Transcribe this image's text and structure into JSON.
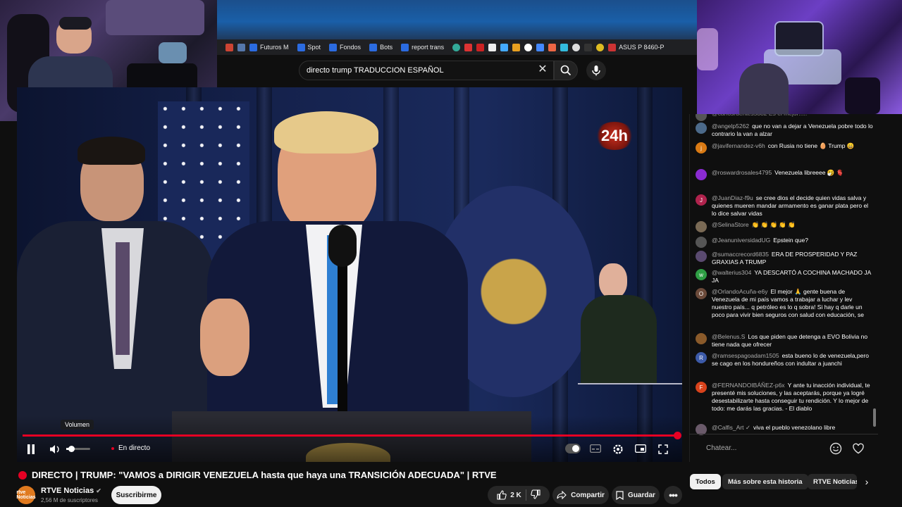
{
  "bookmarks": [
    "Futuros M",
    "Spot",
    "Fondos",
    "Bots",
    "report trans",
    "ASUS P 8460-P"
  ],
  "search": {
    "query": "directo trump TRADUCCION ESPAÑOL"
  },
  "video": {
    "overlay_logo": "24h",
    "progress": 0.99,
    "volume_tooltip": "Volumen",
    "live_label": "En directo"
  },
  "chat": {
    "first_partial": "@carlosruentes5882  Es el mejor!!!!!",
    "messages": [
      {
        "author": "@angelp5262",
        "text": "que no van a dejar a Venezuela pobre todo lo contrario la van a alzar",
        "avatar_color": "#4c6a8a",
        "avatar_letter": ""
      },
      {
        "author": "@javifernandez-v6h",
        "text": "con Rusia no tiene 🥚 Trump 😄",
        "avatar_color": "#d97a14",
        "avatar_letter": "j"
      },
      {
        "author": "@roswardrosales4795",
        "text": "Venezuela libreeee 🤧 🫀",
        "avatar_color": "#8a2bd1",
        "avatar_letter": ""
      },
      {
        "author": "@JuanDiaz-f9u",
        "text": "se cree dios el decide quien vidas salva y quienes mueren mandar armamento es ganar plata pero el lo dice salvar vidas",
        "avatar_color": "#b0234d",
        "avatar_letter": "J"
      },
      {
        "author": "@SelinaStore",
        "text": "👏 👏 👏 👏 👏",
        "avatar_color": "#7a6a55",
        "avatar_letter": ""
      },
      {
        "author": "@JeanuniversidadUG",
        "text": "Epstein que?",
        "avatar_color": "#555555",
        "avatar_letter": ""
      },
      {
        "author": "@sumaccrecord6835",
        "text": "ERA DE PROSPERIDAD Y PAZ GRAXIAS A TRUMP",
        "avatar_color": "#5a4a70",
        "avatar_letter": ""
      },
      {
        "author": "@walterius304",
        "text": "YA DESCARTÓ A COCHINA MACHADO JA JA",
        "avatar_color": "#2e9e44",
        "avatar_letter": "w"
      },
      {
        "author": "@OrlandoAcuña-e6y",
        "text": "El mejor 🙏 gente buena de Venezuela de mi país vamos a trabajar a luchar y lev nuestro país... q petróleo es lo q sobra! Si hay q darle un poco para vivir bien seguros con salud con educación, se",
        "avatar_color": "#6b4a3a",
        "avatar_letter": "O"
      },
      {
        "author": "@Belenus.S",
        "text": "Los que piden que detenga a EVO Bolivia no tiene nada que ofrecer",
        "avatar_color": "#8a5a2a",
        "avatar_letter": ""
      },
      {
        "author": "@ramsespagoadam1505",
        "text": "esta bueno lo de venezuela,pero se cago en los hondureños con indultar a juanchi",
        "avatar_color": "#3c5aa8",
        "avatar_letter": "R"
      },
      {
        "author": "@FERNANDOIBÁÑEZ-p6x",
        "text": "Y ante tu inacción individual, te presenté mis soluciones, y las aceptarás, porque ya logré desestabilizarte hasta conseguir tu rendición. Y lo mejor de todo: me darás las gracias. - El diablo",
        "avatar_color": "#d9431c",
        "avatar_letter": "F"
      },
      {
        "author": "@Calfis_Art ✓",
        "text": "viva el pueblo venezolano libre",
        "avatar_color": "#6a5a6a",
        "avatar_letter": ""
      }
    ],
    "input_placeholder": "Chatear..."
  },
  "title": "DIRECTO | TRUMP: \"VAMOS a DIRIGIR VENEZUELA hasta que haya una TRANSICIÓN ADECUADA\" | RTVE",
  "channel": {
    "name": "RTVE Noticias",
    "verified": "✔",
    "subscribers": "2,56 M de suscriptores",
    "avatar_text": "rtve Noticias",
    "subscribe_label": "Suscribirme"
  },
  "actions": {
    "likes": "2 K",
    "share": "Compartir",
    "save": "Guardar"
  },
  "chips": [
    "Todos",
    "Más sobre esta historia",
    "RTVE Noticias"
  ]
}
